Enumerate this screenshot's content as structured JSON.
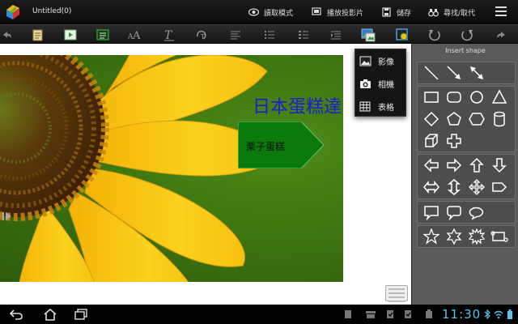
{
  "titlebar": {
    "document_title": "Untitled(0)",
    "read_mode": "讀取模式",
    "slideshow": "播放投影片",
    "save": "儲存",
    "find_replace": "尋找/取代",
    "icons": [
      "app-logo-icon",
      "eye-icon",
      "slideshow-icon",
      "save-icon",
      "binoculars-icon",
      "menu-icon"
    ]
  },
  "toolbar": {
    "tools": [
      "undo-icon",
      "notes-icon",
      "play-icon",
      "text-box-icon",
      "font-size-icon",
      "text-format-icon",
      "text-rotate-icon",
      "align-icon",
      "bullet-list-icon",
      "numbered-list-icon",
      "indent-icon",
      "insert-image-icon",
      "shape-icon",
      "rotate-left-icon",
      "rotate-right-icon",
      "redo-icon"
    ]
  },
  "insert_menu": {
    "items": [
      {
        "label": "影像",
        "icon": "image-icon"
      },
      {
        "label": "相機",
        "icon": "camera-icon"
      },
      {
        "label": "表格",
        "icon": "table-icon"
      }
    ]
  },
  "canvas": {
    "text_box": "日本蛋糕達",
    "arrow_shape_text": "栗子蛋糕",
    "arrow_color": "#0a7a0a",
    "text_color": "#1c1cd0"
  },
  "shape_panel": {
    "title": "Insert shape",
    "lines": [
      "line-icon",
      "arrow-line-icon",
      "double-arrow-line-icon"
    ],
    "basic": [
      "rectangle-icon",
      "rounded-rectangle-icon",
      "circle-icon",
      "triangle-icon",
      "diamond-icon",
      "pentagon-icon",
      "hexagon-icon",
      "cylinder-icon",
      "cube-icon",
      "cross-icon"
    ],
    "arrows": [
      "left-arrow-icon",
      "right-arrow-icon",
      "up-arrow-icon",
      "down-arrow-icon",
      "left-right-arrow-icon",
      "up-down-arrow-icon",
      "quad-arrow-icon",
      "pentagon-arrow-icon"
    ],
    "callouts": [
      "rect-callout-icon",
      "rounded-callout-icon",
      "oval-callout-icon"
    ],
    "stars": [
      "star5-icon",
      "star6-icon",
      "star-burst-icon",
      "scroll-icon"
    ]
  },
  "sysbar": {
    "clock": "11:30",
    "clock_color": "#5cc0e8"
  }
}
